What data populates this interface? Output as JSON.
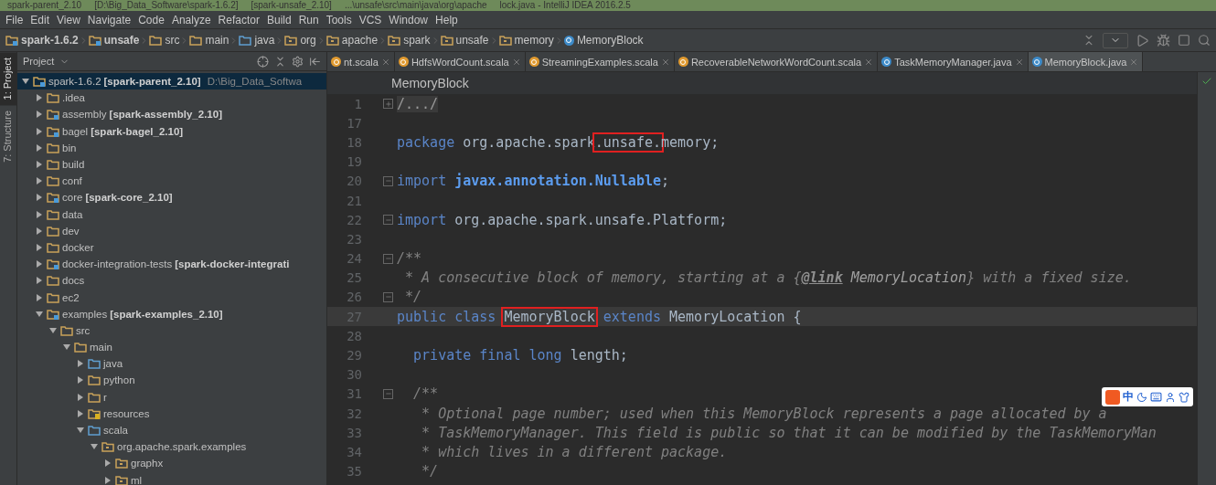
{
  "title_bar": [
    "spark-parent_2.10",
    "[D:\\Big_Data_Software\\spark-1.6.2]",
    "[spark-unsafe_2.10]",
    "...\\unsafe\\src\\main\\java\\org\\apache",
    "lock.java - IntelliJ IDEA 2016.2.5"
  ],
  "menu": [
    "File",
    "Edit",
    "View",
    "Navigate",
    "Code",
    "Analyze",
    "Refactor",
    "Build",
    "Run",
    "Tools",
    "VCS",
    "Window",
    "Help"
  ],
  "breadcrumbs": [
    {
      "label": "spark-1.6.2",
      "kind": "module"
    },
    {
      "label": "unsafe",
      "kind": "module"
    },
    {
      "label": "src",
      "kind": "folder"
    },
    {
      "label": "main",
      "kind": "folder"
    },
    {
      "label": "java",
      "kind": "source"
    },
    {
      "label": "org",
      "kind": "package"
    },
    {
      "label": "apache",
      "kind": "package"
    },
    {
      "label": "spark",
      "kind": "package"
    },
    {
      "label": "unsafe",
      "kind": "package"
    },
    {
      "label": "memory",
      "kind": "package"
    },
    {
      "label": "MemoryBlock",
      "kind": "class"
    }
  ],
  "tool_strip": [
    {
      "label": "1: Project",
      "selected": true
    },
    {
      "label": "7: Structure",
      "selected": false
    }
  ],
  "project_panel": {
    "title": "Project",
    "tree": [
      {
        "name": "spark-1.6.2",
        "module": "[spark-parent_2.10]",
        "path": "D:\\Big_Data_Softwa",
        "kind": "module",
        "expanded": true,
        "selected": true,
        "children": [
          {
            "name": ".idea",
            "kind": "folder",
            "expanded": false,
            "selected": false
          },
          {
            "name": "assembly",
            "module": "[spark-assembly_2.10]",
            "kind": "module",
            "expanded": false,
            "selected": false
          },
          {
            "name": "bagel",
            "module": "[spark-bagel_2.10]",
            "kind": "module",
            "expanded": false,
            "selected": false
          },
          {
            "name": "bin",
            "kind": "folder",
            "expanded": false,
            "selected": false
          },
          {
            "name": "build",
            "kind": "folder",
            "expanded": false,
            "selected": false
          },
          {
            "name": "conf",
            "kind": "folder",
            "expanded": false,
            "selected": false
          },
          {
            "name": "core",
            "module": "[spark-core_2.10]",
            "kind": "module",
            "expanded": false,
            "selected": false
          },
          {
            "name": "data",
            "kind": "folder",
            "expanded": false,
            "selected": false
          },
          {
            "name": "dev",
            "kind": "folder",
            "expanded": false,
            "selected": false
          },
          {
            "name": "docker",
            "kind": "folder",
            "expanded": false,
            "selected": false
          },
          {
            "name": "docker-integration-tests",
            "module": "[spark-docker-integrati",
            "kind": "module",
            "expanded": false,
            "selected": false
          },
          {
            "name": "docs",
            "kind": "folder",
            "expanded": false,
            "selected": false
          },
          {
            "name": "ec2",
            "kind": "folder",
            "expanded": false,
            "selected": false
          },
          {
            "name": "examples",
            "module": "[spark-examples_2.10]",
            "kind": "module",
            "expanded": true,
            "selected": false,
            "children": [
              {
                "name": "src",
                "kind": "folder",
                "expanded": true,
                "selected": false,
                "children": [
                  {
                    "name": "main",
                    "kind": "folder",
                    "expanded": true,
                    "selected": false,
                    "children": [
                      {
                        "name": "java",
                        "kind": "source",
                        "expanded": false,
                        "selected": false
                      },
                      {
                        "name": "python",
                        "kind": "folder",
                        "expanded": false,
                        "selected": false
                      },
                      {
                        "name": "r",
                        "kind": "folder",
                        "expanded": false,
                        "selected": false
                      },
                      {
                        "name": "resources",
                        "kind": "resource",
                        "expanded": false,
                        "selected": false
                      },
                      {
                        "name": "scala",
                        "kind": "source",
                        "expanded": true,
                        "selected": false,
                        "children": [
                          {
                            "name": "org.apache.spark.examples",
                            "kind": "package",
                            "expanded": true,
                            "selected": false,
                            "children": [
                              {
                                "name": "graphx",
                                "kind": "package",
                                "expanded": false,
                                "selected": false
                              },
                              {
                                "name": "ml",
                                "kind": "package",
                                "expanded": false,
                                "selected": false
                              }
                            ]
                          }
                        ]
                      }
                    ]
                  }
                ]
              }
            ]
          }
        ]
      }
    ]
  },
  "tabs": [
    {
      "label": "nt.scala",
      "kind": "object",
      "selected": false
    },
    {
      "label": "HdfsWordCount.scala",
      "kind": "object",
      "selected": false
    },
    {
      "label": "StreamingExamples.scala",
      "kind": "object",
      "selected": false
    },
    {
      "label": "RecoverableNetworkWordCount.scala",
      "kind": "object",
      "selected": false
    },
    {
      "label": "TaskMemoryManager.java",
      "kind": "class",
      "selected": false
    },
    {
      "label": "MemoryBlock.java",
      "kind": "class",
      "selected": true
    }
  ],
  "editor": {
    "header": "MemoryBlock",
    "lines": [
      {
        "number": "1",
        "kind": "folded",
        "tokens": [
          {
            "text": "/.../",
            "kind": "folded"
          }
        ]
      },
      {
        "number": "17",
        "kind": "plain"
      },
      {
        "number": "18",
        "kind": "plain",
        "tokens": [
          {
            "text": "package",
            "kind": "keyword"
          },
          {
            "text": " org.apache.spark",
            "kind": "plain"
          },
          {
            "text": ".unsafe.",
            "kind": "plain",
            "boxed": true
          },
          {
            "text": "memory;",
            "kind": "plain"
          }
        ]
      },
      {
        "number": "19",
        "kind": "plain"
      },
      {
        "number": "20",
        "kind": "fold-start",
        "tokens": [
          {
            "text": "import",
            "kind": "keyword"
          },
          {
            "text": " javax.annotation.Nullable",
            "kind": "strong"
          },
          {
            "text": ";",
            "kind": "plain"
          }
        ]
      },
      {
        "number": "21",
        "kind": "plain"
      },
      {
        "number": "22",
        "kind": "fold-end",
        "tokens": [
          {
            "text": "import",
            "kind": "keyword"
          },
          {
            "text": " org.apache.spark.unsafe.Platform;",
            "kind": "plain"
          }
        ]
      },
      {
        "number": "23",
        "kind": "plain"
      },
      {
        "number": "24",
        "kind": "fold-start",
        "tokens": [
          {
            "text": "/**",
            "kind": "comment"
          }
        ]
      },
      {
        "number": "25",
        "kind": "plain",
        "tokens": [
          {
            "text": " * A consecutive block of memory, starting at a {",
            "kind": "comment"
          },
          {
            "text": "@link",
            "kind": "doc-tag"
          },
          {
            "text": " MemoryLocation",
            "kind": "doc-ref"
          },
          {
            "text": "} with a fixed size.",
            "kind": "comment"
          }
        ]
      },
      {
        "number": "26",
        "kind": "fold-end",
        "tokens": [
          {
            "text": " */",
            "kind": "comment"
          }
        ]
      },
      {
        "number": "27",
        "kind": "plain",
        "current": true,
        "tokens": [
          {
            "text": "public class ",
            "kind": "keyword"
          },
          {
            "text": "MemoryBlock",
            "kind": "plain",
            "boxed": true
          },
          {
            "text": " extends",
            "kind": "keyword"
          },
          {
            "text": " MemoryLocation {",
            "kind": "plain"
          }
        ]
      },
      {
        "number": "28",
        "kind": "plain"
      },
      {
        "number": "29",
        "kind": "plain",
        "tokens": [
          {
            "text": "  private final long",
            "kind": "keyword"
          },
          {
            "text": " length;",
            "kind": "plain"
          }
        ]
      },
      {
        "number": "30",
        "kind": "plain"
      },
      {
        "number": "31",
        "kind": "fold-start",
        "tokens": [
          {
            "text": "  /**",
            "kind": "comment"
          }
        ]
      },
      {
        "number": "32",
        "kind": "plain",
        "tokens": [
          {
            "text": "   * Optional page number; used when this MemoryBlock represents a page allocated by a",
            "kind": "comment"
          }
        ]
      },
      {
        "number": "33",
        "kind": "plain",
        "tokens": [
          {
            "text": "   * TaskMemoryManager. This field is public so that it can be modified by the TaskMemoryMan",
            "kind": "comment"
          }
        ]
      },
      {
        "number": "34",
        "kind": "plain",
        "tokens": [
          {
            "text": "   * which lives in a different package.",
            "kind": "comment"
          }
        ]
      },
      {
        "number": "35",
        "kind": "plain",
        "tokens": [
          {
            "text": "   */",
            "kind": "comment"
          }
        ]
      }
    ]
  },
  "ime_toolbar": {
    "label": "中"
  }
}
